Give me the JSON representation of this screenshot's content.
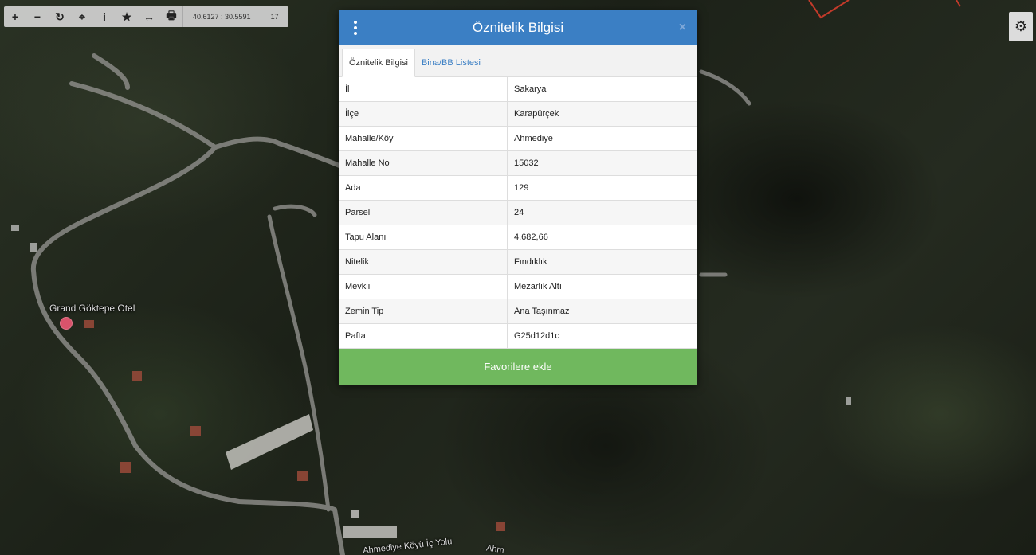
{
  "toolbar": {
    "buttons": [
      {
        "name": "zoom-in-button",
        "icon": "plus-icon",
        "glyph": "+"
      },
      {
        "name": "zoom-out-button",
        "icon": "minus-icon",
        "glyph": "−"
      },
      {
        "name": "refresh-button",
        "icon": "refresh-icon",
        "glyph": "↻"
      },
      {
        "name": "locate-button",
        "icon": "crosshair-icon",
        "glyph": "⌖"
      },
      {
        "name": "info-button",
        "icon": "info-icon",
        "glyph": "i"
      },
      {
        "name": "favorite-button",
        "icon": "star-icon",
        "glyph": "★"
      },
      {
        "name": "measure-button",
        "icon": "arrows-horizontal-icon",
        "glyph": "↔"
      },
      {
        "name": "print-button",
        "icon": "print-icon",
        "glyph": "🖶"
      }
    ],
    "coordinates": "40.6127 : 30.5591",
    "zoom_level": "17"
  },
  "map": {
    "poi_label": "Grand Göktepe Otel",
    "road_label_1": "Ahmediye Köyü İç Yolu",
    "road_label_2": "Ahm"
  },
  "settings": {
    "icon": "gear-icon",
    "glyph": "⚙"
  },
  "modal": {
    "title": "Öznitelik Bilgisi",
    "menu_icon": "vertical-dots-icon",
    "close_glyph": "×",
    "tabs": [
      {
        "label": "Öznitelik Bilgisi",
        "active": true
      },
      {
        "label": "Bina/BB Listesi",
        "active": false
      }
    ],
    "rows": [
      {
        "key": "İl",
        "value": "Sakarya"
      },
      {
        "key": "İlçe",
        "value": "Karapürçek"
      },
      {
        "key": "Mahalle/Köy",
        "value": "Ahmediye"
      },
      {
        "key": "Mahalle No",
        "value": "15032"
      },
      {
        "key": "Ada",
        "value": "129"
      },
      {
        "key": "Parsel",
        "value": "24"
      },
      {
        "key": "Tapu Alanı",
        "value": "4.682,66"
      },
      {
        "key": "Nitelik",
        "value": "Fındıklık"
      },
      {
        "key": "Mevkii",
        "value": "Mezarlık Altı"
      },
      {
        "key": "Zemin Tip",
        "value": "Ana Taşınmaz"
      },
      {
        "key": "Pafta",
        "value": "G25d12d1c"
      }
    ],
    "favorite_label": "Favorilere ekle"
  },
  "colors": {
    "header_blue": "#3b7fc4",
    "favorite_green": "#70b85e",
    "tab_link": "#3b7fc4"
  }
}
